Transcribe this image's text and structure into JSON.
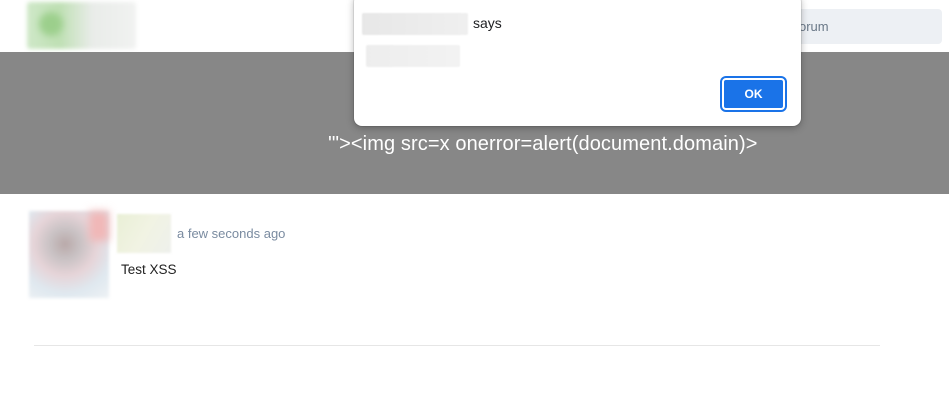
{
  "header": {
    "search_placeholder_visible": "orum"
  },
  "banner": {
    "title": "'\"><img src=x onerror=alert(document.domain)>"
  },
  "post": {
    "timestamp": "a few seconds ago",
    "body": "Test XSS"
  },
  "dialog": {
    "says_label": "says",
    "ok_label": "OK"
  },
  "colors": {
    "banner_bg": "#878787",
    "ok_button": "#1a73e8",
    "search_bg": "#edf0f4"
  }
}
